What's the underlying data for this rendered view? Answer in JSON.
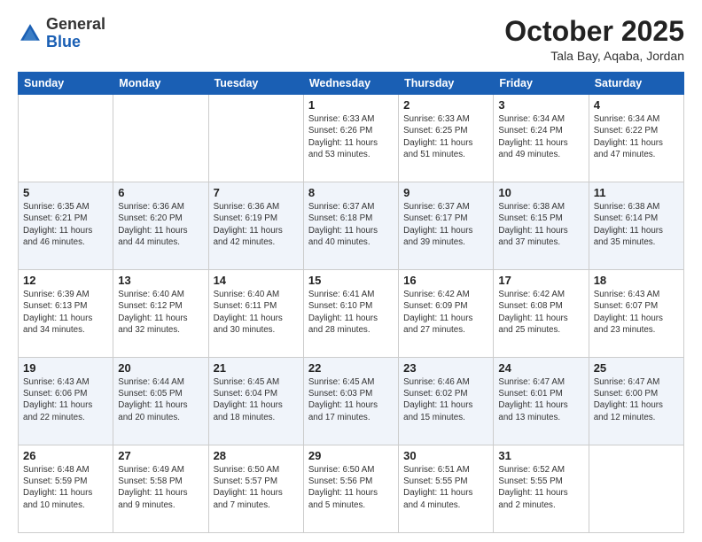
{
  "header": {
    "logo_general": "General",
    "logo_blue": "Blue",
    "month_title": "October 2025",
    "location": "Tala Bay, Aqaba, Jordan"
  },
  "days_of_week": [
    "Sunday",
    "Monday",
    "Tuesday",
    "Wednesday",
    "Thursday",
    "Friday",
    "Saturday"
  ],
  "weeks": [
    [
      {
        "day": "",
        "content": ""
      },
      {
        "day": "",
        "content": ""
      },
      {
        "day": "",
        "content": ""
      },
      {
        "day": "1",
        "content": "Sunrise: 6:33 AM\nSunset: 6:26 PM\nDaylight: 11 hours and 53 minutes."
      },
      {
        "day": "2",
        "content": "Sunrise: 6:33 AM\nSunset: 6:25 PM\nDaylight: 11 hours and 51 minutes."
      },
      {
        "day": "3",
        "content": "Sunrise: 6:34 AM\nSunset: 6:24 PM\nDaylight: 11 hours and 49 minutes."
      },
      {
        "day": "4",
        "content": "Sunrise: 6:34 AM\nSunset: 6:22 PM\nDaylight: 11 hours and 47 minutes."
      }
    ],
    [
      {
        "day": "5",
        "content": "Sunrise: 6:35 AM\nSunset: 6:21 PM\nDaylight: 11 hours and 46 minutes."
      },
      {
        "day": "6",
        "content": "Sunrise: 6:36 AM\nSunset: 6:20 PM\nDaylight: 11 hours and 44 minutes."
      },
      {
        "day": "7",
        "content": "Sunrise: 6:36 AM\nSunset: 6:19 PM\nDaylight: 11 hours and 42 minutes."
      },
      {
        "day": "8",
        "content": "Sunrise: 6:37 AM\nSunset: 6:18 PM\nDaylight: 11 hours and 40 minutes."
      },
      {
        "day": "9",
        "content": "Sunrise: 6:37 AM\nSunset: 6:17 PM\nDaylight: 11 hours and 39 minutes."
      },
      {
        "day": "10",
        "content": "Sunrise: 6:38 AM\nSunset: 6:15 PM\nDaylight: 11 hours and 37 minutes."
      },
      {
        "day": "11",
        "content": "Sunrise: 6:38 AM\nSunset: 6:14 PM\nDaylight: 11 hours and 35 minutes."
      }
    ],
    [
      {
        "day": "12",
        "content": "Sunrise: 6:39 AM\nSunset: 6:13 PM\nDaylight: 11 hours and 34 minutes."
      },
      {
        "day": "13",
        "content": "Sunrise: 6:40 AM\nSunset: 6:12 PM\nDaylight: 11 hours and 32 minutes."
      },
      {
        "day": "14",
        "content": "Sunrise: 6:40 AM\nSunset: 6:11 PM\nDaylight: 11 hours and 30 minutes."
      },
      {
        "day": "15",
        "content": "Sunrise: 6:41 AM\nSunset: 6:10 PM\nDaylight: 11 hours and 28 minutes."
      },
      {
        "day": "16",
        "content": "Sunrise: 6:42 AM\nSunset: 6:09 PM\nDaylight: 11 hours and 27 minutes."
      },
      {
        "day": "17",
        "content": "Sunrise: 6:42 AM\nSunset: 6:08 PM\nDaylight: 11 hours and 25 minutes."
      },
      {
        "day": "18",
        "content": "Sunrise: 6:43 AM\nSunset: 6:07 PM\nDaylight: 11 hours and 23 minutes."
      }
    ],
    [
      {
        "day": "19",
        "content": "Sunrise: 6:43 AM\nSunset: 6:06 PM\nDaylight: 11 hours and 22 minutes."
      },
      {
        "day": "20",
        "content": "Sunrise: 6:44 AM\nSunset: 6:05 PM\nDaylight: 11 hours and 20 minutes."
      },
      {
        "day": "21",
        "content": "Sunrise: 6:45 AM\nSunset: 6:04 PM\nDaylight: 11 hours and 18 minutes."
      },
      {
        "day": "22",
        "content": "Sunrise: 6:45 AM\nSunset: 6:03 PM\nDaylight: 11 hours and 17 minutes."
      },
      {
        "day": "23",
        "content": "Sunrise: 6:46 AM\nSunset: 6:02 PM\nDaylight: 11 hours and 15 minutes."
      },
      {
        "day": "24",
        "content": "Sunrise: 6:47 AM\nSunset: 6:01 PM\nDaylight: 11 hours and 13 minutes."
      },
      {
        "day": "25",
        "content": "Sunrise: 6:47 AM\nSunset: 6:00 PM\nDaylight: 11 hours and 12 minutes."
      }
    ],
    [
      {
        "day": "26",
        "content": "Sunrise: 6:48 AM\nSunset: 5:59 PM\nDaylight: 11 hours and 10 minutes."
      },
      {
        "day": "27",
        "content": "Sunrise: 6:49 AM\nSunset: 5:58 PM\nDaylight: 11 hours and 9 minutes."
      },
      {
        "day": "28",
        "content": "Sunrise: 6:50 AM\nSunset: 5:57 PM\nDaylight: 11 hours and 7 minutes."
      },
      {
        "day": "29",
        "content": "Sunrise: 6:50 AM\nSunset: 5:56 PM\nDaylight: 11 hours and 5 minutes."
      },
      {
        "day": "30",
        "content": "Sunrise: 6:51 AM\nSunset: 5:55 PM\nDaylight: 11 hours and 4 minutes."
      },
      {
        "day": "31",
        "content": "Sunrise: 6:52 AM\nSunset: 5:55 PM\nDaylight: 11 hours and 2 minutes."
      },
      {
        "day": "",
        "content": ""
      }
    ]
  ]
}
